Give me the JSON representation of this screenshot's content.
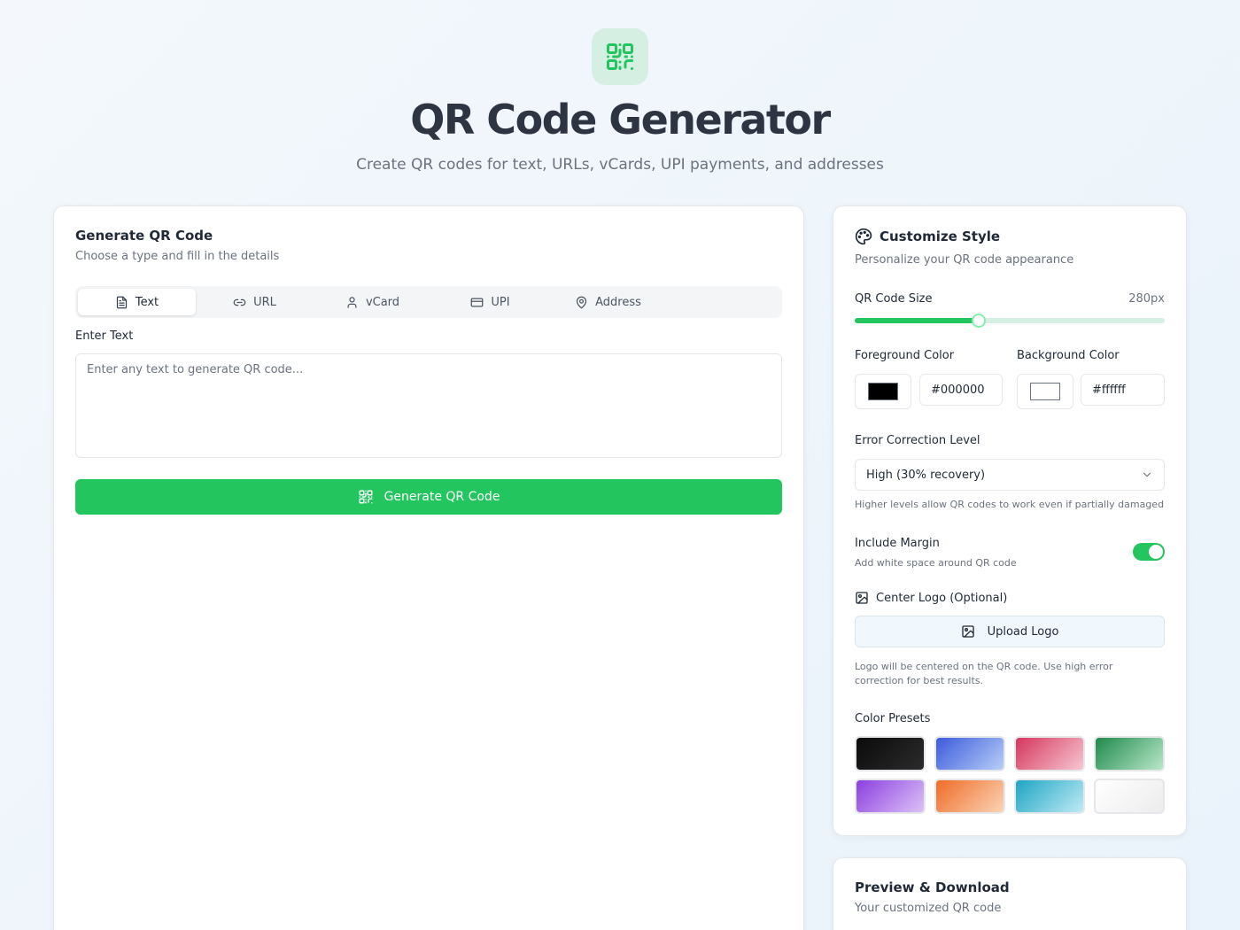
{
  "hero": {
    "title": "QR Code Generator",
    "subtitle": "Create QR codes for text, URLs, vCards, UPI payments, and addresses",
    "icon": "qr-code-icon"
  },
  "generate": {
    "title": "Generate QR Code",
    "description": "Choose a type and fill in the details",
    "tabs": [
      {
        "label": "Text",
        "icon": "file-text-icon",
        "active": true
      },
      {
        "label": "URL",
        "icon": "link-icon",
        "active": false
      },
      {
        "label": "vCard",
        "icon": "user-icon",
        "active": false
      },
      {
        "label": "UPI",
        "icon": "credit-card-icon",
        "active": false
      },
      {
        "label": "Address",
        "icon": "map-pin-icon",
        "active": false
      }
    ],
    "input_label": "Enter Text",
    "input_placeholder": "Enter any text to generate QR code...",
    "input_value": "",
    "button_label": "Generate QR Code"
  },
  "style": {
    "title": "Customize Style",
    "description": "Personalize your QR code appearance",
    "size_label": "QR Code Size",
    "size_value": "280px",
    "size_fraction": 0.4,
    "foreground_label": "Foreground Color",
    "foreground_hex": "#000000",
    "background_label": "Background Color",
    "background_hex": "#ffffff",
    "error_label": "Error Correction Level",
    "error_value": "High (30% recovery)",
    "error_hint": "Higher levels allow QR codes to work even if partially damaged",
    "margin_label": "Include Margin",
    "margin_hint": "Add white space around QR code",
    "margin_enabled": true,
    "logo_label": "Center Logo (Optional)",
    "upload_label": "Upload Logo",
    "logo_hint_1": "Logo will be centered on the QR code. Use high error",
    "logo_hint_2": "correction for best results.",
    "presets_label": "Color Presets",
    "presets": [
      {
        "name": "black",
        "from": "#0b0b0b",
        "to": "#2b2b2b"
      },
      {
        "name": "blue",
        "from": "#3b5bdb",
        "to": "#b8cdf7"
      },
      {
        "name": "crimson",
        "from": "#d6365d",
        "to": "#f6c7d1"
      },
      {
        "name": "green",
        "from": "#1f8a4c",
        "to": "#b9e7c9"
      },
      {
        "name": "purple",
        "from": "#8b3fe0",
        "to": "#dcc2f7"
      },
      {
        "name": "orange",
        "from": "#ef6c26",
        "to": "#fbd3b6"
      },
      {
        "name": "teal",
        "from": "#1ea5c4",
        "to": "#bfeaf4"
      },
      {
        "name": "white",
        "from": "#ffffff",
        "to": "#ececec"
      }
    ]
  },
  "preview": {
    "title": "Preview & Download",
    "description": "Your customized QR code"
  },
  "colors": {
    "accent": "#22c55e",
    "accent_soft": "#d5f0e2"
  }
}
